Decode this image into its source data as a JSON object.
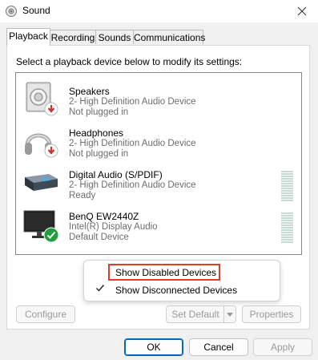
{
  "window": {
    "title": "Sound"
  },
  "tabs": [
    {
      "label": "Playback"
    },
    {
      "label": "Recording"
    },
    {
      "label": "Sounds"
    },
    {
      "label": "Communications"
    }
  ],
  "instruction": "Select a playback device below to modify its settings:",
  "devices": [
    {
      "name": "Speakers",
      "driver": "2- High Definition Audio Device",
      "status": "Not plugged in",
      "icon": "speaker-icon",
      "badge": "not-plugged-badge-icon"
    },
    {
      "name": "Headphones",
      "driver": "2- High Definition Audio Device",
      "status": "Not plugged in",
      "icon": "headphones-icon",
      "badge": "not-plugged-badge-icon"
    },
    {
      "name": "Digital Audio (S/PDIF)",
      "driver": "2- High Definition Audio Device",
      "status": "Ready",
      "icon": "digital-audio-icon"
    },
    {
      "name": "BenQ EW2440Z",
      "driver": "Intel(R) Display Audio",
      "status": "Default Device",
      "icon": "monitor-icon",
      "badge": "default-device-check-icon"
    }
  ],
  "context_menu": {
    "items": [
      {
        "label": "Show Disabled Devices",
        "checked": false
      },
      {
        "label": "Show Disconnected Devices",
        "checked": true
      }
    ]
  },
  "buttons": {
    "configure": "Configure",
    "set_default": "Set Default",
    "properties": "Properties",
    "ok": "OK",
    "cancel": "Cancel",
    "apply": "Apply"
  },
  "colors": {
    "accent": "#0067c0",
    "highlight_box": "#e03c2a",
    "default_check": "#1f9e3b",
    "badge_red": "#d3302a"
  }
}
